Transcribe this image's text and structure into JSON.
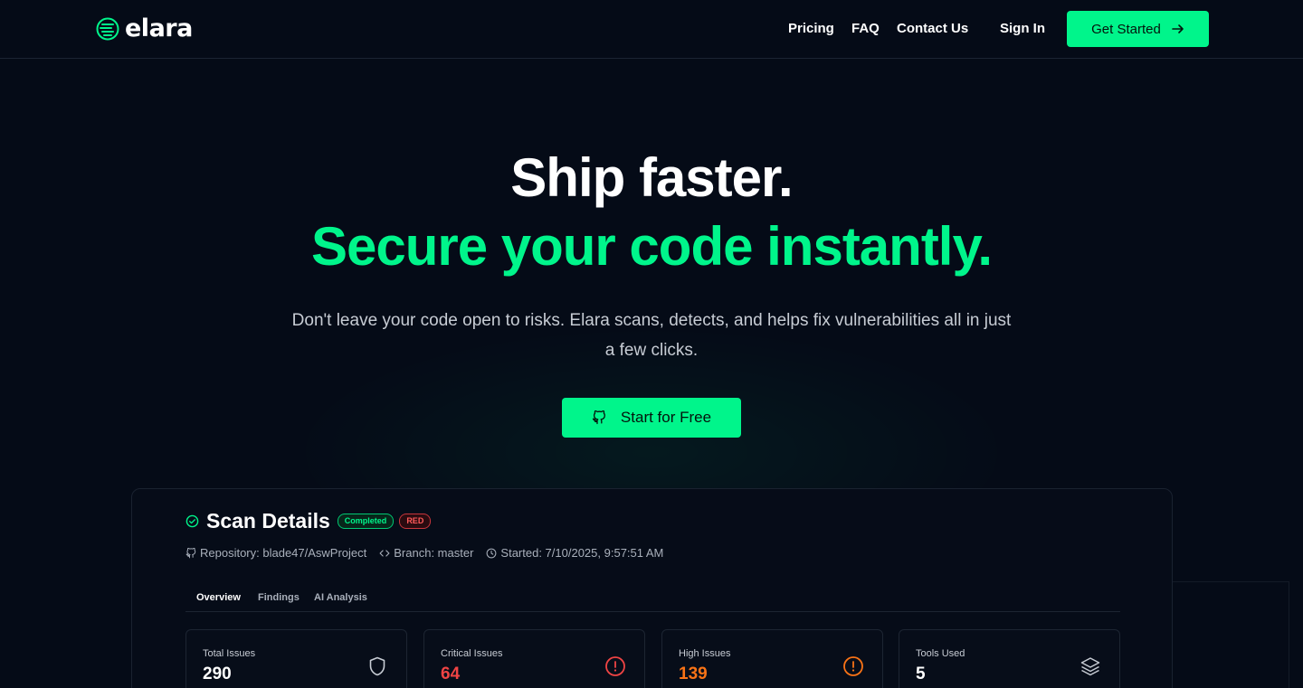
{
  "brand": {
    "name": "elara",
    "accent": "#00f58b"
  },
  "nav": {
    "pricing": "Pricing",
    "faq": "FAQ",
    "contact": "Contact Us",
    "signin": "Sign In",
    "get_started": "Get Started"
  },
  "hero": {
    "title_line1": "Ship faster.",
    "title_line2": "Secure your code instantly.",
    "subtitle": "Don't leave your code open to risks. Elara scans, detects, and helps fix vulnerabilities all in just a few clicks.",
    "cta": "Start for Free"
  },
  "scan": {
    "title": "Scan Details",
    "status_badge": "Completed",
    "risk_badge": "RED",
    "repository": "Repository: blade47/AswProject",
    "branch": "Branch: master",
    "started": "Started: 7/10/2025, 9:57:51 AM",
    "tabs": [
      {
        "label": "Overview",
        "active": true
      },
      {
        "label": "Findings",
        "active": false
      },
      {
        "label": "AI Analysis",
        "active": false
      }
    ],
    "stats": [
      {
        "label": "Total Issues",
        "value": "290",
        "color": "#ffffff",
        "icon": "shield-icon"
      },
      {
        "label": "Critical Issues",
        "value": "64",
        "color": "#ef4444",
        "icon": "alert-circle-icon"
      },
      {
        "label": "High Issues",
        "value": "139",
        "color": "#f97316",
        "icon": "alert-circle-icon"
      },
      {
        "label": "Tools Used",
        "value": "5",
        "color": "#ffffff",
        "icon": "layers-icon"
      }
    ]
  }
}
